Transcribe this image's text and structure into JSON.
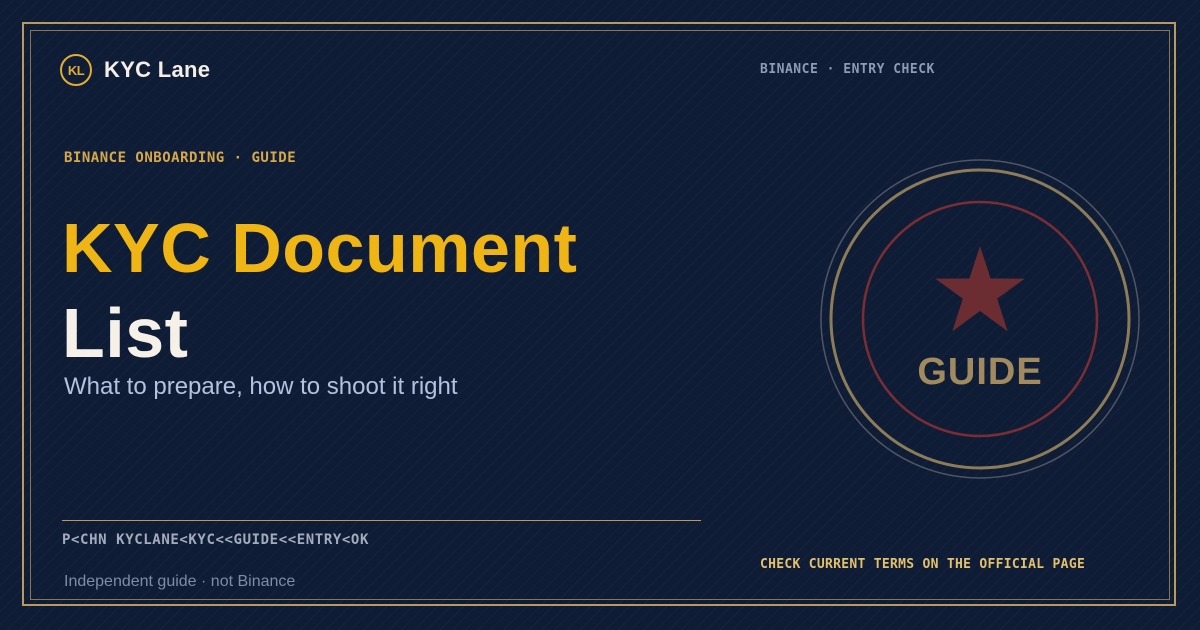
{
  "brand": {
    "badge": "KL",
    "name": "KYC Lane"
  },
  "header": {
    "right_label": "BINANCE · ENTRY CHECK"
  },
  "hero": {
    "eyebrow": "BINANCE ONBOARDING · GUIDE",
    "title_line1": "KYC Document",
    "title_line2": "List",
    "subtitle": "What to prepare, how to shoot it right"
  },
  "footer": {
    "mrz_line": "P<CHN KYCLANE<KYC<<GUIDE<<ENTRY<OK",
    "disclaimer": "Independent guide · not Binance",
    "check_terms": "CHECK CURRENT TERMS ON THE OFFICIAL PAGE"
  },
  "seal": {
    "label": "GUIDE",
    "icon": "star-icon"
  },
  "colors": {
    "background": "#0f1c36",
    "gold": "#efb514",
    "frame_gold": "#b89a5c",
    "seal_red": "#8a2e34",
    "seal_text": "#a08a5e",
    "title_white": "#f5f1e8"
  }
}
